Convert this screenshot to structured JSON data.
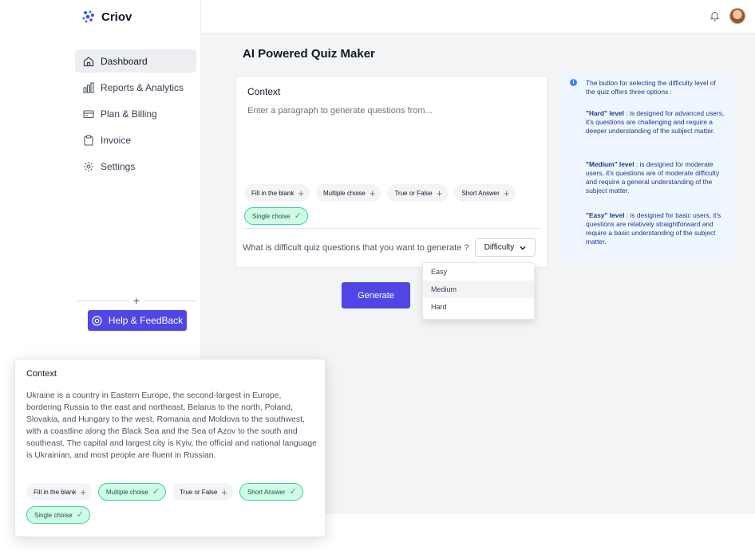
{
  "brand": {
    "name": "Criov",
    "accent": "#4f46e5"
  },
  "sidebar": {
    "items": [
      {
        "label": "Dashboard",
        "icon": "home-icon",
        "active": true
      },
      {
        "label": "Reports & Analytics",
        "icon": "chart-icon",
        "active": false
      },
      {
        "label": "Plan & Billing",
        "icon": "credit-card-icon",
        "active": false
      },
      {
        "label": "Invoice",
        "icon": "clipboard-icon",
        "active": false
      },
      {
        "label": "Settings",
        "icon": "gear-icon",
        "active": false
      }
    ],
    "help_label": "Help & FeedBack"
  },
  "topbar": {
    "icons": [
      "bell-icon",
      "avatar"
    ]
  },
  "main": {
    "title": "AI Powered Quiz Maker",
    "context_card": {
      "title": "Context",
      "placeholder": "Enter a paragraph to generate questions from...",
      "chips": [
        {
          "label": "Fill in the blank",
          "selected": false
        },
        {
          "label": "Multiple choise",
          "selected": false
        },
        {
          "label": "True or False",
          "selected": false
        },
        {
          "label": "Short Answer",
          "selected": false
        },
        {
          "label": "Single choise",
          "selected": true
        }
      ],
      "question": "What is difficult quiz questions that you want to generate ?",
      "difficulty_label": "Difficulty"
    },
    "dropdown": {
      "options": [
        "Easy",
        "Medium",
        "Hard"
      ],
      "hovered": "Medium"
    },
    "generate_label": "Generate",
    "info": {
      "intro": "The button for selecting the difficulty level of the quiz offers three options :",
      "hard_title": "\"Hard\" level",
      "hard_text": " : is designed for advanced users, it's questions are challenging and require a deeper understanding of the subject matter.",
      "medium_title": "\"Medium\" level",
      "medium_text": " : is designed for moderate users, it's questions are of moderate difficulty and require a general understanding of the subject matter.",
      "easy_title": "\"Easy\" level",
      "easy_text": " : is designed for basic users, it's questions are relatively straightforward and require a basic understanding of the subject matter."
    }
  },
  "float_card": {
    "title": "Context",
    "text": "Ukraine is a country in Eastern Europe, the second-largest in Europe, bordering Russia to the east and northeast, Belarus to the north, Poland, Slovakia, and Hungary to the west, Romania and Moldova to the southwest, with a coastline along the Black Sea and the Sea of Azov to the south and southeast. The capital and largest city is Kyiv, the official and national language is Ukrainian, and most people are fluent in Russian.",
    "chips": [
      {
        "label": "Fill in the blank",
        "selected": false
      },
      {
        "label": "Multiple choise",
        "selected": true
      },
      {
        "label": "True or False",
        "selected": false
      },
      {
        "label": "Short Answer",
        "selected": true
      },
      {
        "label": "Single choise",
        "selected": true
      }
    ]
  }
}
